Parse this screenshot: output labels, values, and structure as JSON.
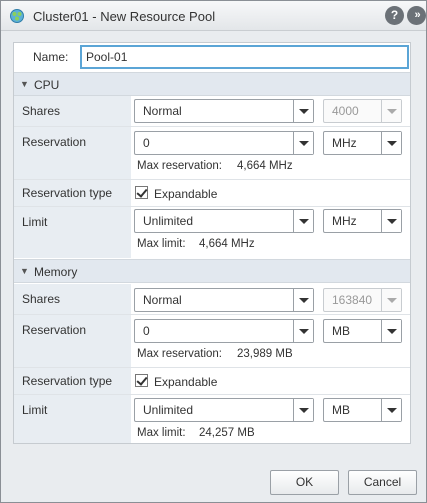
{
  "window": {
    "title": "Cluster01 - New Resource Pool",
    "help_icon": "?",
    "more_icon": "»"
  },
  "name": {
    "label": "Name:",
    "value": "Pool-01"
  },
  "cpu": {
    "section_label": "CPU",
    "shares": {
      "label": "Shares",
      "selected": "Normal",
      "number": "4000"
    },
    "reservation": {
      "label": "Reservation",
      "value": "0",
      "unit": "MHz",
      "max_label": "Max reservation:",
      "max_value": "4,664 MHz"
    },
    "reservation_type": {
      "label": "Reservation type",
      "checkbox_label": "Expandable",
      "checked": true
    },
    "limit": {
      "label": "Limit",
      "value": "Unlimited",
      "unit": "MHz",
      "max_label": "Max limit:",
      "max_value": "4,664 MHz"
    }
  },
  "memory": {
    "section_label": "Memory",
    "shares": {
      "label": "Shares",
      "selected": "Normal",
      "number": "163840"
    },
    "reservation": {
      "label": "Reservation",
      "value": "0",
      "unit": "MB",
      "max_label": "Max reservation:",
      "max_value": "23,989 MB"
    },
    "reservation_type": {
      "label": "Reservation type",
      "checkbox_label": "Expandable",
      "checked": true
    },
    "limit": {
      "label": "Limit",
      "value": "Unlimited",
      "unit": "MB",
      "max_label": "Max limit:",
      "max_value": "24,257 MB"
    }
  },
  "footer": {
    "ok_label": "OK",
    "cancel_label": "Cancel"
  }
}
